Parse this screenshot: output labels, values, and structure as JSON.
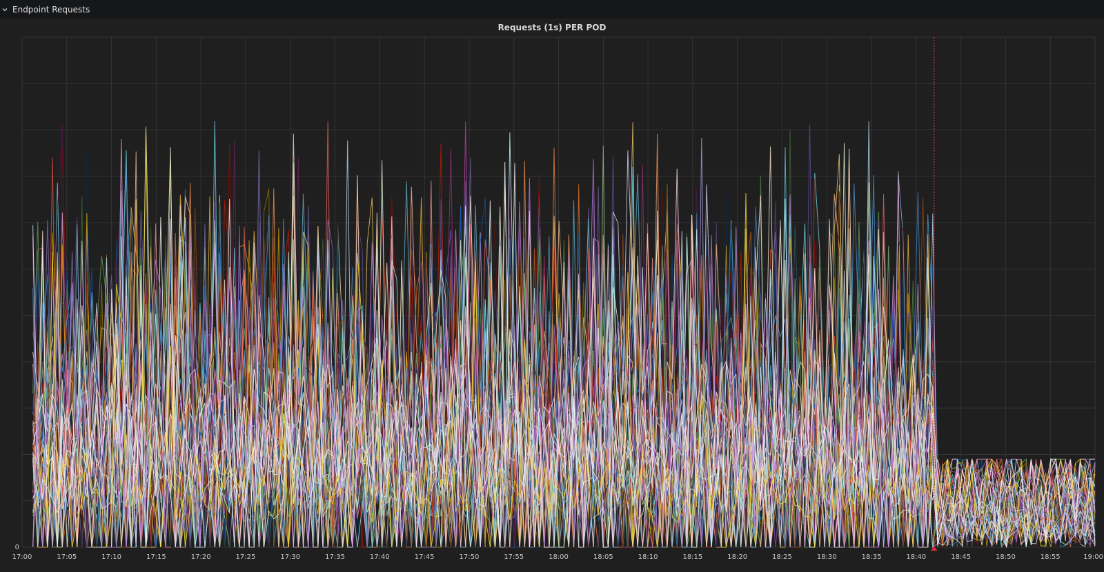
{
  "row": {
    "title": "Endpoint Requests",
    "collapse_icon": "chevron-down-icon"
  },
  "panel": {
    "title": "Requests (1s) PER POD"
  },
  "chart_data": {
    "type": "line",
    "title": "Requests (1s) PER POD",
    "xlabel": "",
    "ylabel": "",
    "x_ticks": [
      "17:00",
      "17:05",
      "17:10",
      "17:15",
      "17:20",
      "17:25",
      "17:30",
      "17:35",
      "17:40",
      "17:45",
      "17:50",
      "17:55",
      "18:00",
      "18:05",
      "18:10",
      "18:15",
      "18:20",
      "18:25",
      "18:30",
      "18:35",
      "18:40",
      "18:45",
      "18:50",
      "18:55",
      "19:00"
    ],
    "xlim": [
      "17:00",
      "19:00"
    ],
    "y_ticks": [
      "0"
    ],
    "ylim": [
      0,
      11
    ],
    "grid": true,
    "legend": "none",
    "series_count": 60,
    "annotations": [
      {
        "type": "vertical-line",
        "time": "18:42",
        "color": "#e02f44"
      }
    ],
    "background": "#1f1f20",
    "series_colors": [
      "#7eb26d",
      "#eab839",
      "#6ed0e0",
      "#ef843c",
      "#e24d42",
      "#1f78c1",
      "#ba43a9",
      "#705da0",
      "#508642",
      "#cca300",
      "#447ebc",
      "#c15c17",
      "#890f02",
      "#0a437c",
      "#6d1f62",
      "#584477",
      "#b7dbab",
      "#f4d598",
      "#70dbed",
      "#f9ba8f",
      "#f29191",
      "#82b5d8",
      "#e5a8e2",
      "#aea2e0",
      "#629e51",
      "#e5ac0e",
      "#64b0c8",
      "#e0752d",
      "#bf1b00",
      "#0a50a1",
      "#962d82",
      "#614d93",
      "#9ac48a",
      "#f2c96d",
      "#65c5db",
      "#f9934e",
      "#ea6460",
      "#5195ce",
      "#d683ce",
      "#806eb7",
      "#3f6833",
      "#967302",
      "#2f575e",
      "#99440a",
      "#58140c",
      "#052b51",
      "#511749",
      "#3f2b5b",
      "#e0f9d7",
      "#fceaca",
      "#cffaff",
      "#f9e2d2",
      "#fce2de",
      "#badff4",
      "#f9d9f9",
      "#dedaf7",
      "#ffffff",
      "#d8d9da",
      "#b877d9",
      "#fade2a"
    ]
  }
}
